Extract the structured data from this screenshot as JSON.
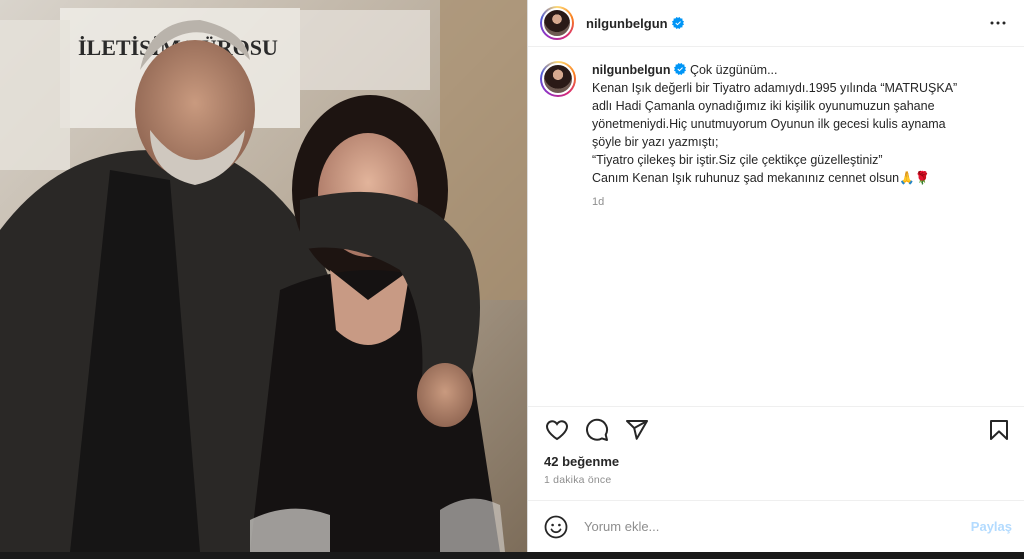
{
  "post": {
    "username": "nilgunbelgun",
    "caption_lines": [
      "Çok üzgünüm...",
      "Kenan Işık değerli bir Tiyatro adamıydı.1995 yılında “MATRUŞKA”",
      "adlı Hadi Çamanla oynadığımız iki kişilik oyunumuzun şahane",
      "yönetmeniydi.Hiç unutmuyorum Oyunun ilk gecesi kulis aynama",
      "şöyle bir yazı yazmıştı;",
      "“Tiyatro çilekeş bir iştir.Siz çile çektikçe güzelleştiniz”",
      "Canım Kenan Işık ruhunuz şad mekanınız cennet olsun🙏🌹"
    ],
    "caption_time": "1d",
    "likes": "42 beğenme",
    "posted_ago": "1 dakika önce",
    "comment_placeholder": "Yorum ekle...",
    "share_label": "Paylaş",
    "photo_sign_text": "İLETİŞİM BÜROSU"
  },
  "icons": {
    "verified": "verified-badge-icon",
    "more": "more-options-icon",
    "like": "heart-icon",
    "comment": "comment-icon",
    "share": "share-icon",
    "save": "bookmark-icon",
    "emoji": "emoji-icon"
  },
  "colors": {
    "verified_blue": "#0095f6",
    "share_disabled": "#b3dbff",
    "text": "#262626",
    "secondary": "#8e8e8e"
  }
}
